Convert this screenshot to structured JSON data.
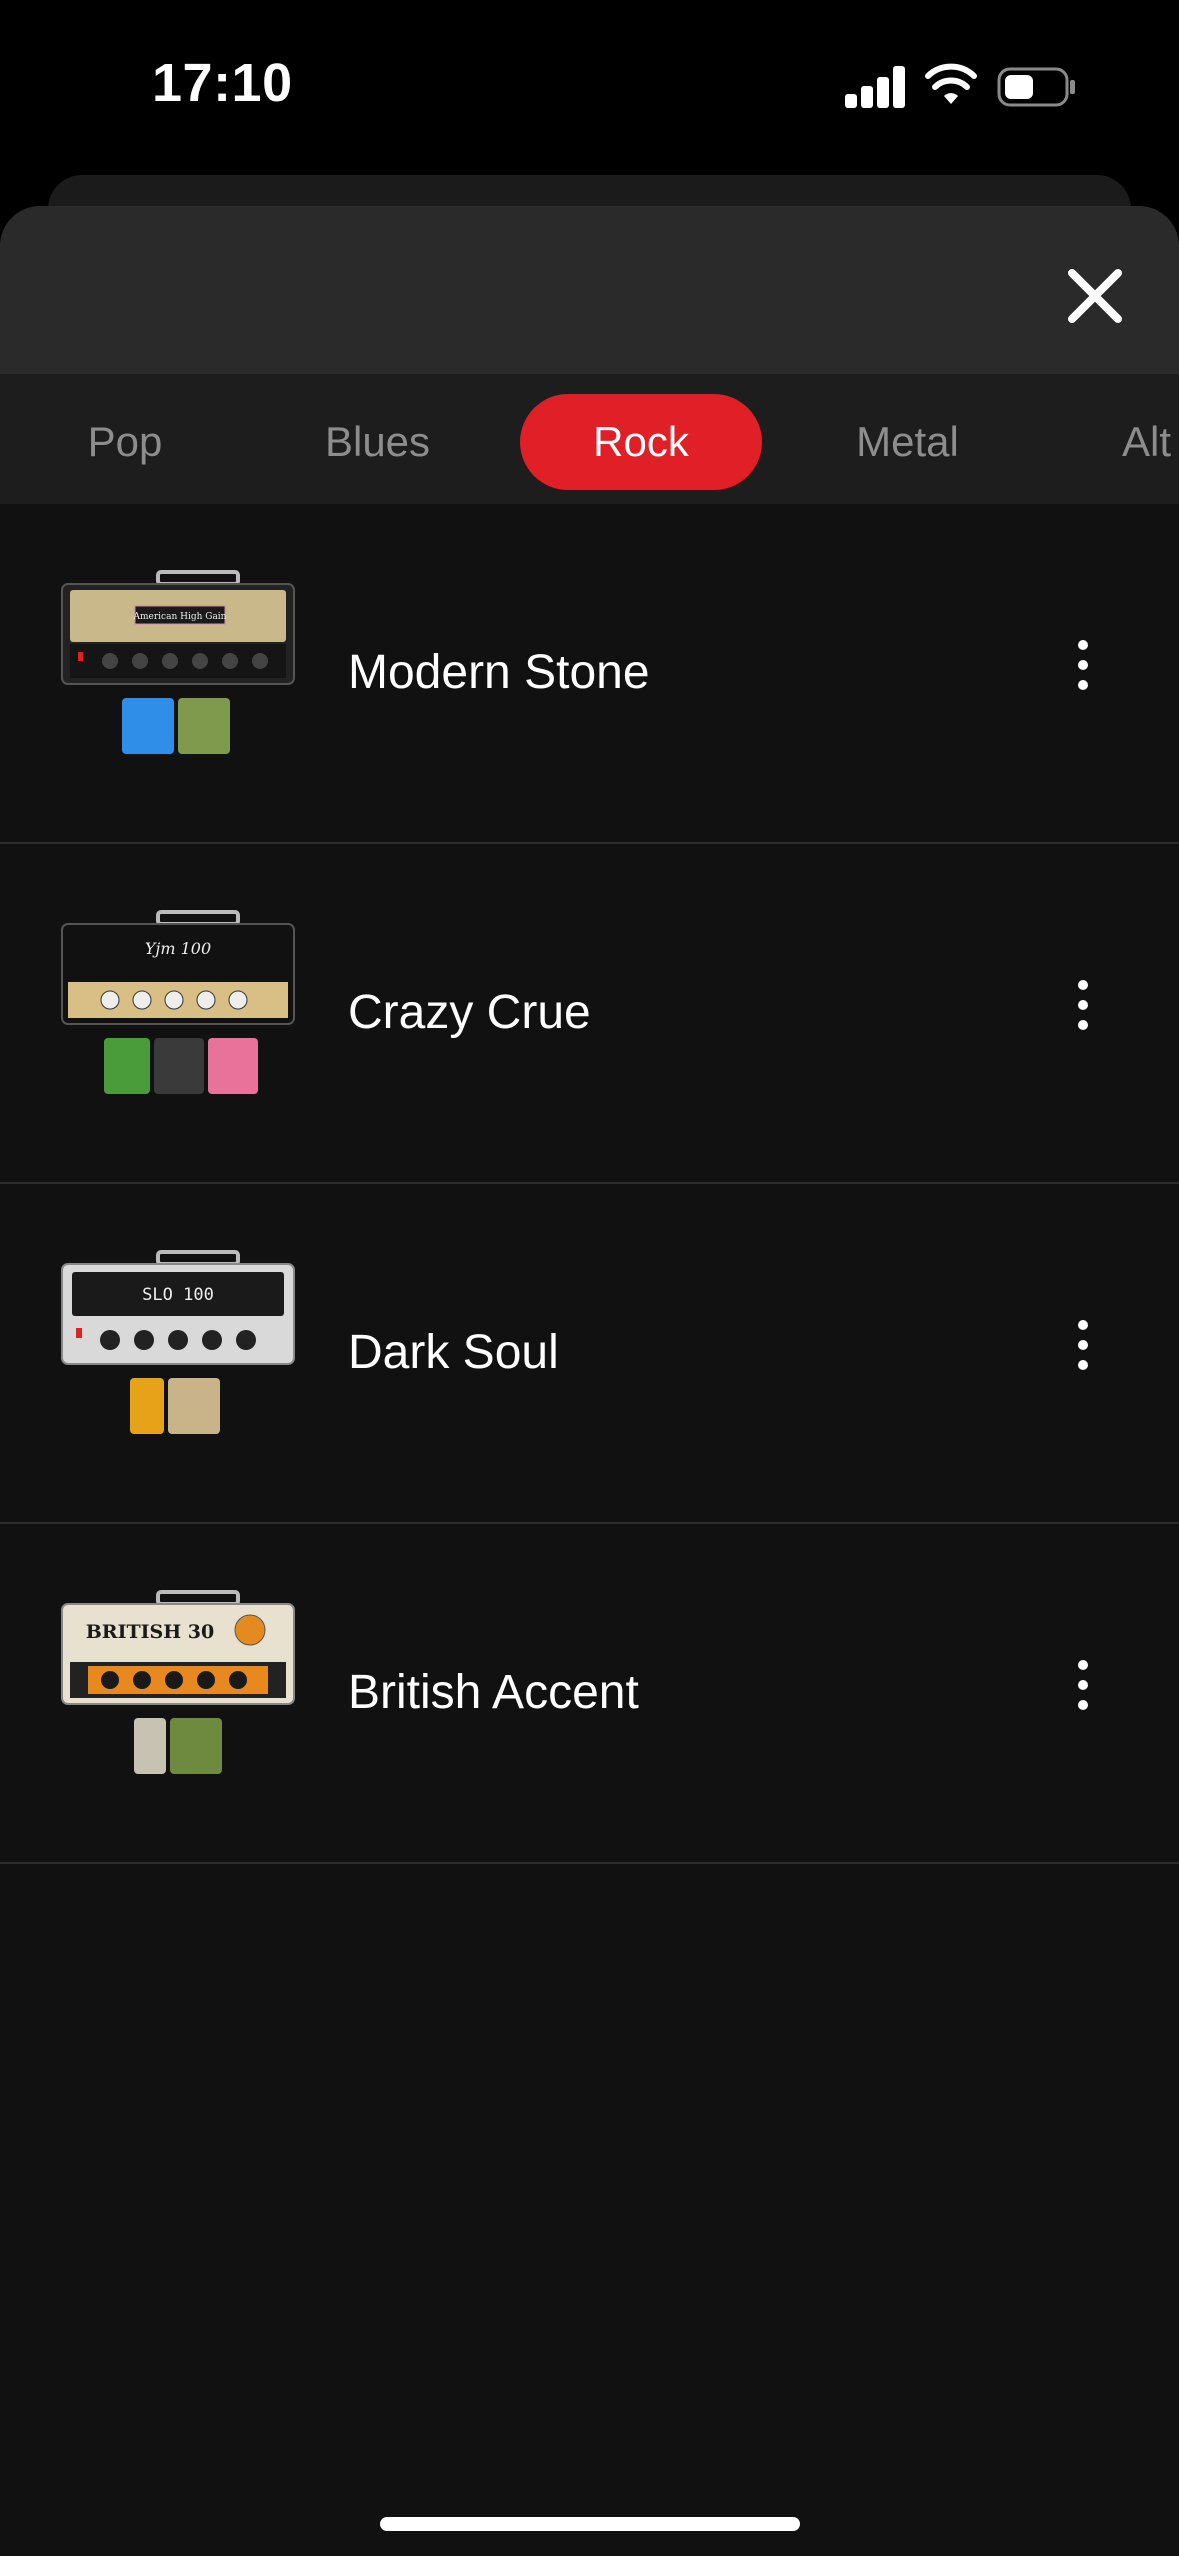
{
  "status_bar": {
    "time": "17:10"
  },
  "tabs": [
    {
      "label": "Pop",
      "active": false
    },
    {
      "label": "Blues",
      "active": false
    },
    {
      "label": "Rock",
      "active": true
    },
    {
      "label": "Metal",
      "active": false
    },
    {
      "label": "Alt",
      "active": false
    }
  ],
  "presets": [
    {
      "name": "Modern Stone",
      "amp_label": "American High Gain",
      "amp_style": "tweed",
      "pedals": [
        "#2f8fe8",
        "#7f9a4c"
      ]
    },
    {
      "name": "Crazy Crue",
      "amp_label": "Yjm 100",
      "amp_style": "black-gold",
      "pedals": [
        "#4a9c3b",
        "#3a3a3a",
        "#e8729a"
      ]
    },
    {
      "name": "Dark Soul",
      "amp_label": "SLO 100",
      "amp_style": "silver",
      "pedals": [
        "#e6a31a",
        "#c9b48a"
      ]
    },
    {
      "name": "British Accent",
      "amp_label": "BRITISH 30",
      "amp_style": "cream-orange",
      "pedals": [
        "#c7c2b2",
        "#6d8a3e"
      ]
    }
  ],
  "colors": {
    "accent": "#e01f26",
    "background": "#111111",
    "tab_bar": "#1d1d1d",
    "header": "#2a2a2a",
    "inactive_text": "#8d8d8d"
  },
  "icons": {
    "close": "close-icon",
    "more": "more-vertical-icon",
    "signal": "cellular-signal-icon",
    "wifi": "wifi-icon",
    "battery": "battery-icon"
  }
}
